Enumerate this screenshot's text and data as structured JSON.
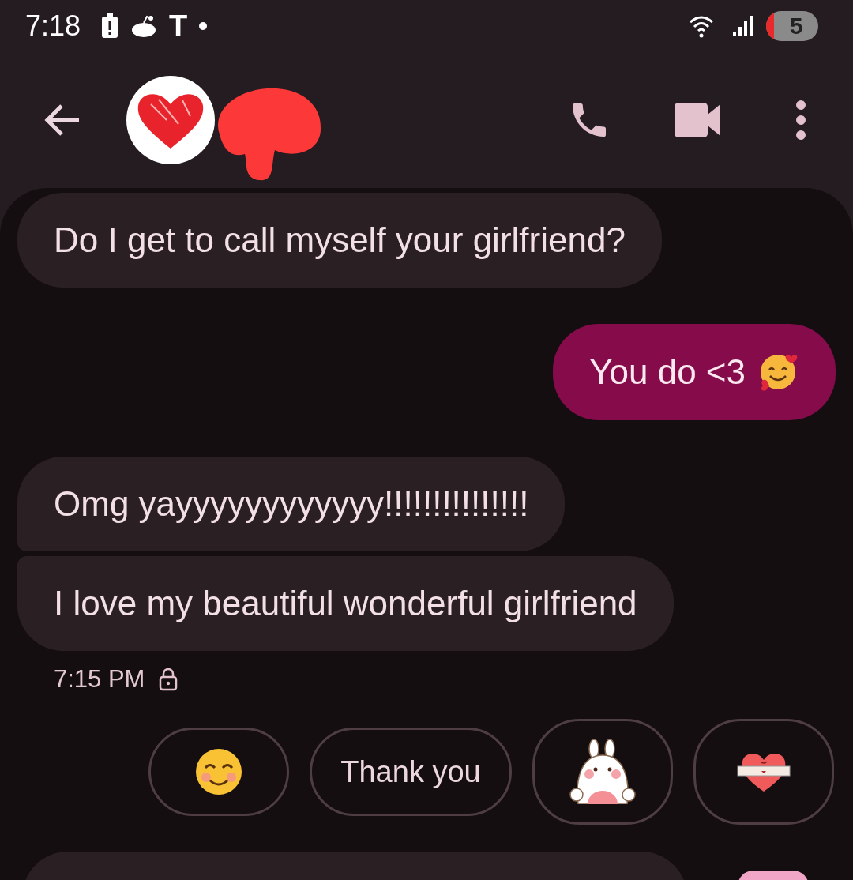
{
  "status_bar": {
    "time": "7:18",
    "notification_letter": "T",
    "battery_badge": "5"
  },
  "messages": [
    {
      "kind": "incoming",
      "text": "Do I get to call myself your girlfriend?"
    },
    {
      "kind": "outgoing",
      "text": "You do <3",
      "emoji": true
    },
    {
      "kind": "incoming",
      "text": "Omg yayyyyyyyyyyyy!!!!!!!!!!!!!!!"
    },
    {
      "kind": "incoming",
      "text": "I love my beautiful wonderful girlfriend"
    }
  ],
  "timestamp": {
    "time": "7:15 PM",
    "encrypted": true
  },
  "suggestions": [
    {
      "kind": "emoji"
    },
    {
      "kind": "text",
      "label": "Thank you"
    },
    {
      "kind": "sticker"
    },
    {
      "kind": "sticker"
    }
  ]
}
